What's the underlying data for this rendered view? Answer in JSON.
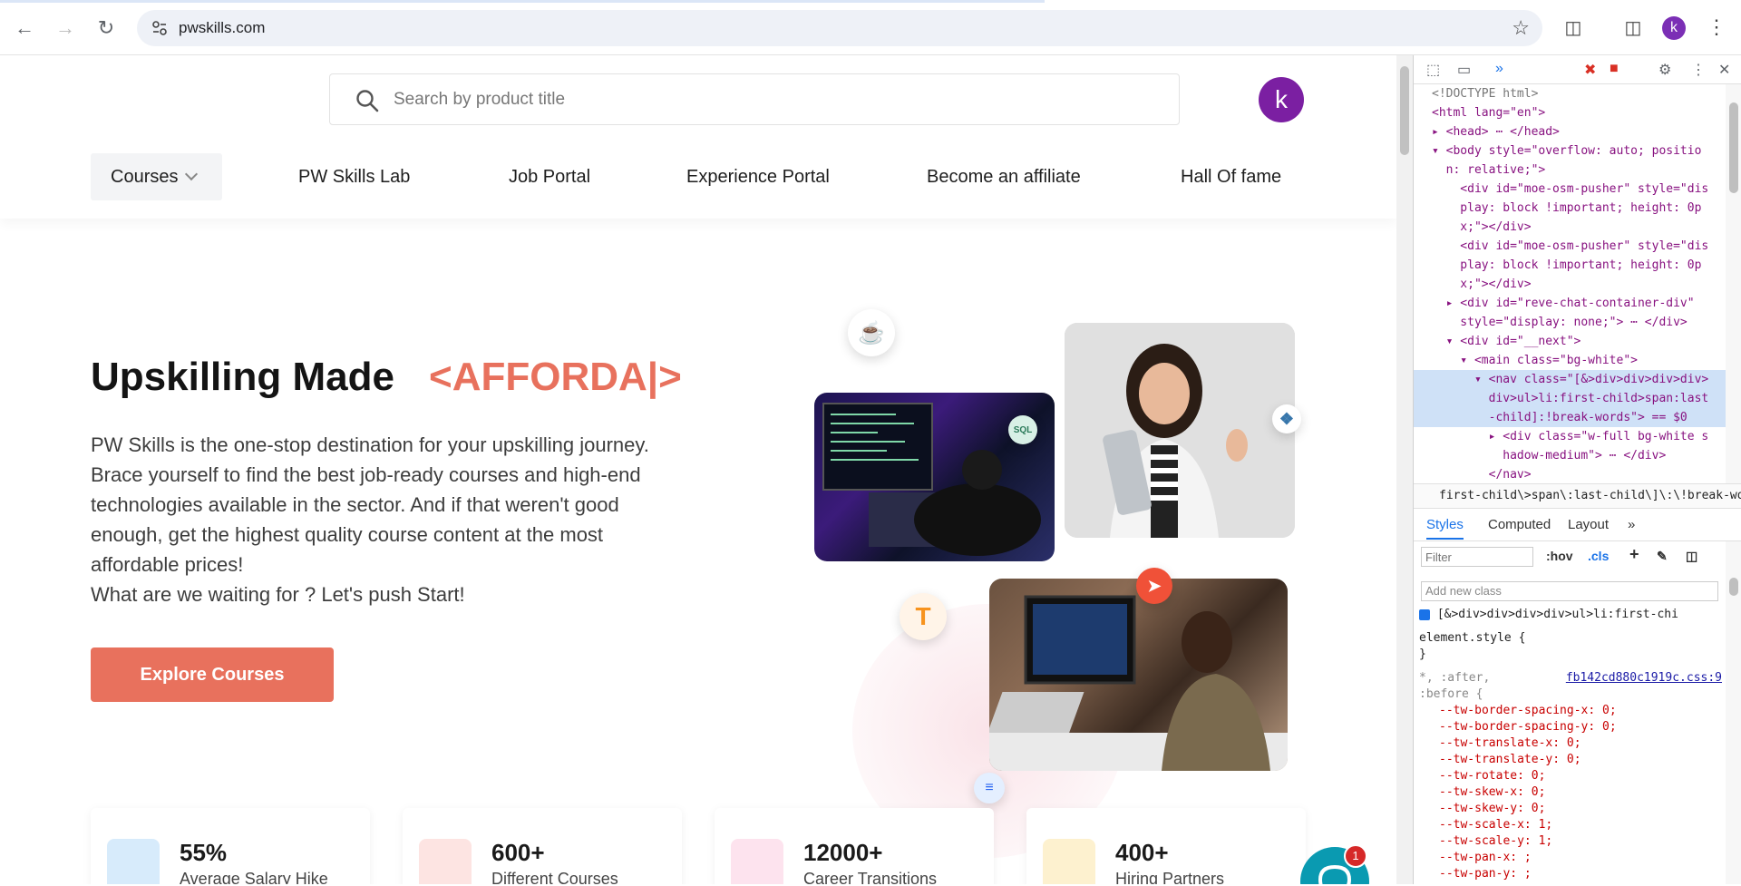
{
  "browser": {
    "url": "pwskills.com",
    "profile_initial": "k"
  },
  "header": {
    "search_placeholder": "Search by product title",
    "avatar_initial": "k",
    "menu": [
      "Courses",
      "PW Skills Lab",
      "Job Portal",
      "Experience Portal",
      "Become an affiliate",
      "Hall Of fame"
    ]
  },
  "hero": {
    "title": "Upskilling Made",
    "typed": "<AFFORDA|>",
    "description_lines": [
      "PW Skills is the one-stop destination for your upskilling journey.",
      "Brace yourself to find the best job-ready courses and high-end",
      "technologies available in the sector. And if that weren't good",
      "enough, get the highest quality course content at the most",
      "affordable prices!",
      "What are we waiting for ? Let's push Start!"
    ],
    "cta": "Explore Courses",
    "badges": {
      "sql": "SQL"
    }
  },
  "stats": [
    {
      "value": "55%",
      "label": "Average Salary Hike",
      "color": "#d7ebfb"
    },
    {
      "value": "600+",
      "label": "Different Courses",
      "color": "#fde4e2"
    },
    {
      "value": "12000+",
      "label": "Career Transitions",
      "color": "#fde3ee"
    },
    {
      "value": "400+",
      "label": "Hiring Partners",
      "color": "#fdf1cf"
    }
  ],
  "chat": {
    "count": "1"
  },
  "devtools": {
    "dom_lines": [
      "<!DOCTYPE html>",
      "<html lang=\"en\">",
      "▸ <head> ⋯ </head>",
      "▾ <body style=\"overflow: auto; positio",
      "  n: relative;\">",
      "    <div id=\"moe-osm-pusher\" style=\"dis",
      "    play: block !important; height: 0p",
      "    x;\"></div>",
      "    <div id=\"moe-osm-pusher\" style=\"dis",
      "    play: block !important; height: 0p",
      "    x;\"></div>",
      "  ▸ <div id=\"reve-chat-container-div\"",
      "    style=\"display: none;\"> ⋯ </div>",
      "  ▾ <div id=\"__next\">",
      "    ▾ <main class=\"bg-white\">",
      "      ▾ <nav class=\"[&>div>div>div>div>",
      "        div>ul>li:first-child>span:last",
      "        -child]:!break-words\"> == $0",
      "        ▸ <div class=\"w-full bg-white s",
      "          hadow-medium\"> ⋯ </div>",
      "        </nav>"
    ],
    "breadcrumb": "first-child\\>span\\:last-child\\]\\:\\!break-words",
    "tabs": [
      "Styles",
      "Computed",
      "Layout",
      "»"
    ],
    "filter_placeholder": "Filter",
    "hov": ":hov",
    "cls": ".cls",
    "add_class_placeholder": "Add new class",
    "rule_checkbox_label": "[&>div>div>div>div>ul>li:first-chi",
    "element_style": "element.style {",
    "close_brace": "}",
    "selector_line1": "*, :after,",
    "selector_line2": ":before {",
    "source_link": "fb142cd880c1919c.css:9",
    "props": [
      "--tw-border-spacing-x: 0;",
      "--tw-border-spacing-y: 0;",
      "--tw-translate-x: 0;",
      "--tw-translate-y: 0;",
      "--tw-rotate: 0;",
      "--tw-skew-x: 0;",
      "--tw-skew-y: 0;",
      "--tw-scale-x: 1;",
      "--tw-scale-y: 1;",
      "--tw-pan-x: ;",
      "--tw-pan-y: ;"
    ]
  }
}
